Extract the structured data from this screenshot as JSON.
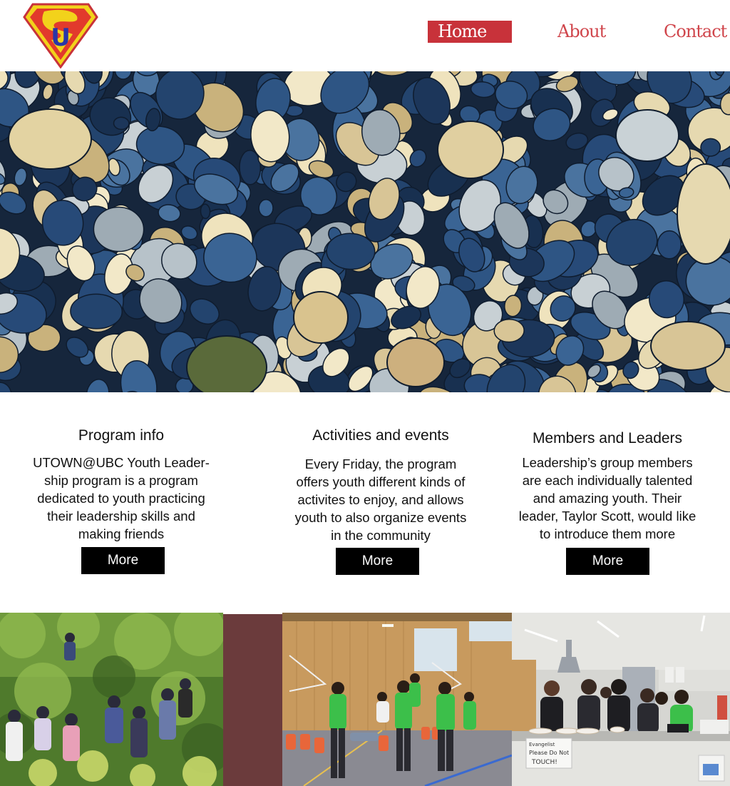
{
  "header": {
    "logo_icon": "superman-style-u-shield-logo",
    "logo_letter": "U",
    "nav": [
      {
        "label": "Home",
        "active": true
      },
      {
        "label": "About",
        "active": false
      },
      {
        "label": "Contact",
        "active": false
      }
    ]
  },
  "hero": {
    "image": "river-pebbles-photo"
  },
  "sections": [
    {
      "title": "Program info",
      "lines": [
        "UTOWN@UBC Youth Leader-",
        "ship program is a program",
        "dedicated to youth practicing",
        "their leadership skills and",
        "making friends"
      ],
      "button": "More"
    },
    {
      "title": "Activities and events",
      "lines": [
        "Every Friday, the program",
        "offers youth different kinds of",
        "activites to enjoy, and allows",
        "youth to also organize events",
        "in the community"
      ],
      "button": "More"
    },
    {
      "title": "Members and Leaders",
      "lines": [
        "Leadership’s group members",
        "are each individually talented",
        "and amazing youth. Their",
        "leader, Taylor Scott, would like",
        "to introduce them more"
      ],
      "button": "More"
    }
  ],
  "gallery": {
    "photos": [
      "forest-hike-group-photo",
      "gym-activity-photo",
      "kitchen-team-photo"
    ],
    "sign_lines": [
      "Evangelist",
      "Please Do Not",
      "TOUCH!"
    ]
  },
  "colors": {
    "accent_red": "#c8323a",
    "nav_text": "#d0464c",
    "button_bg": "#000000",
    "maroon_block": "#6b3b3c"
  }
}
